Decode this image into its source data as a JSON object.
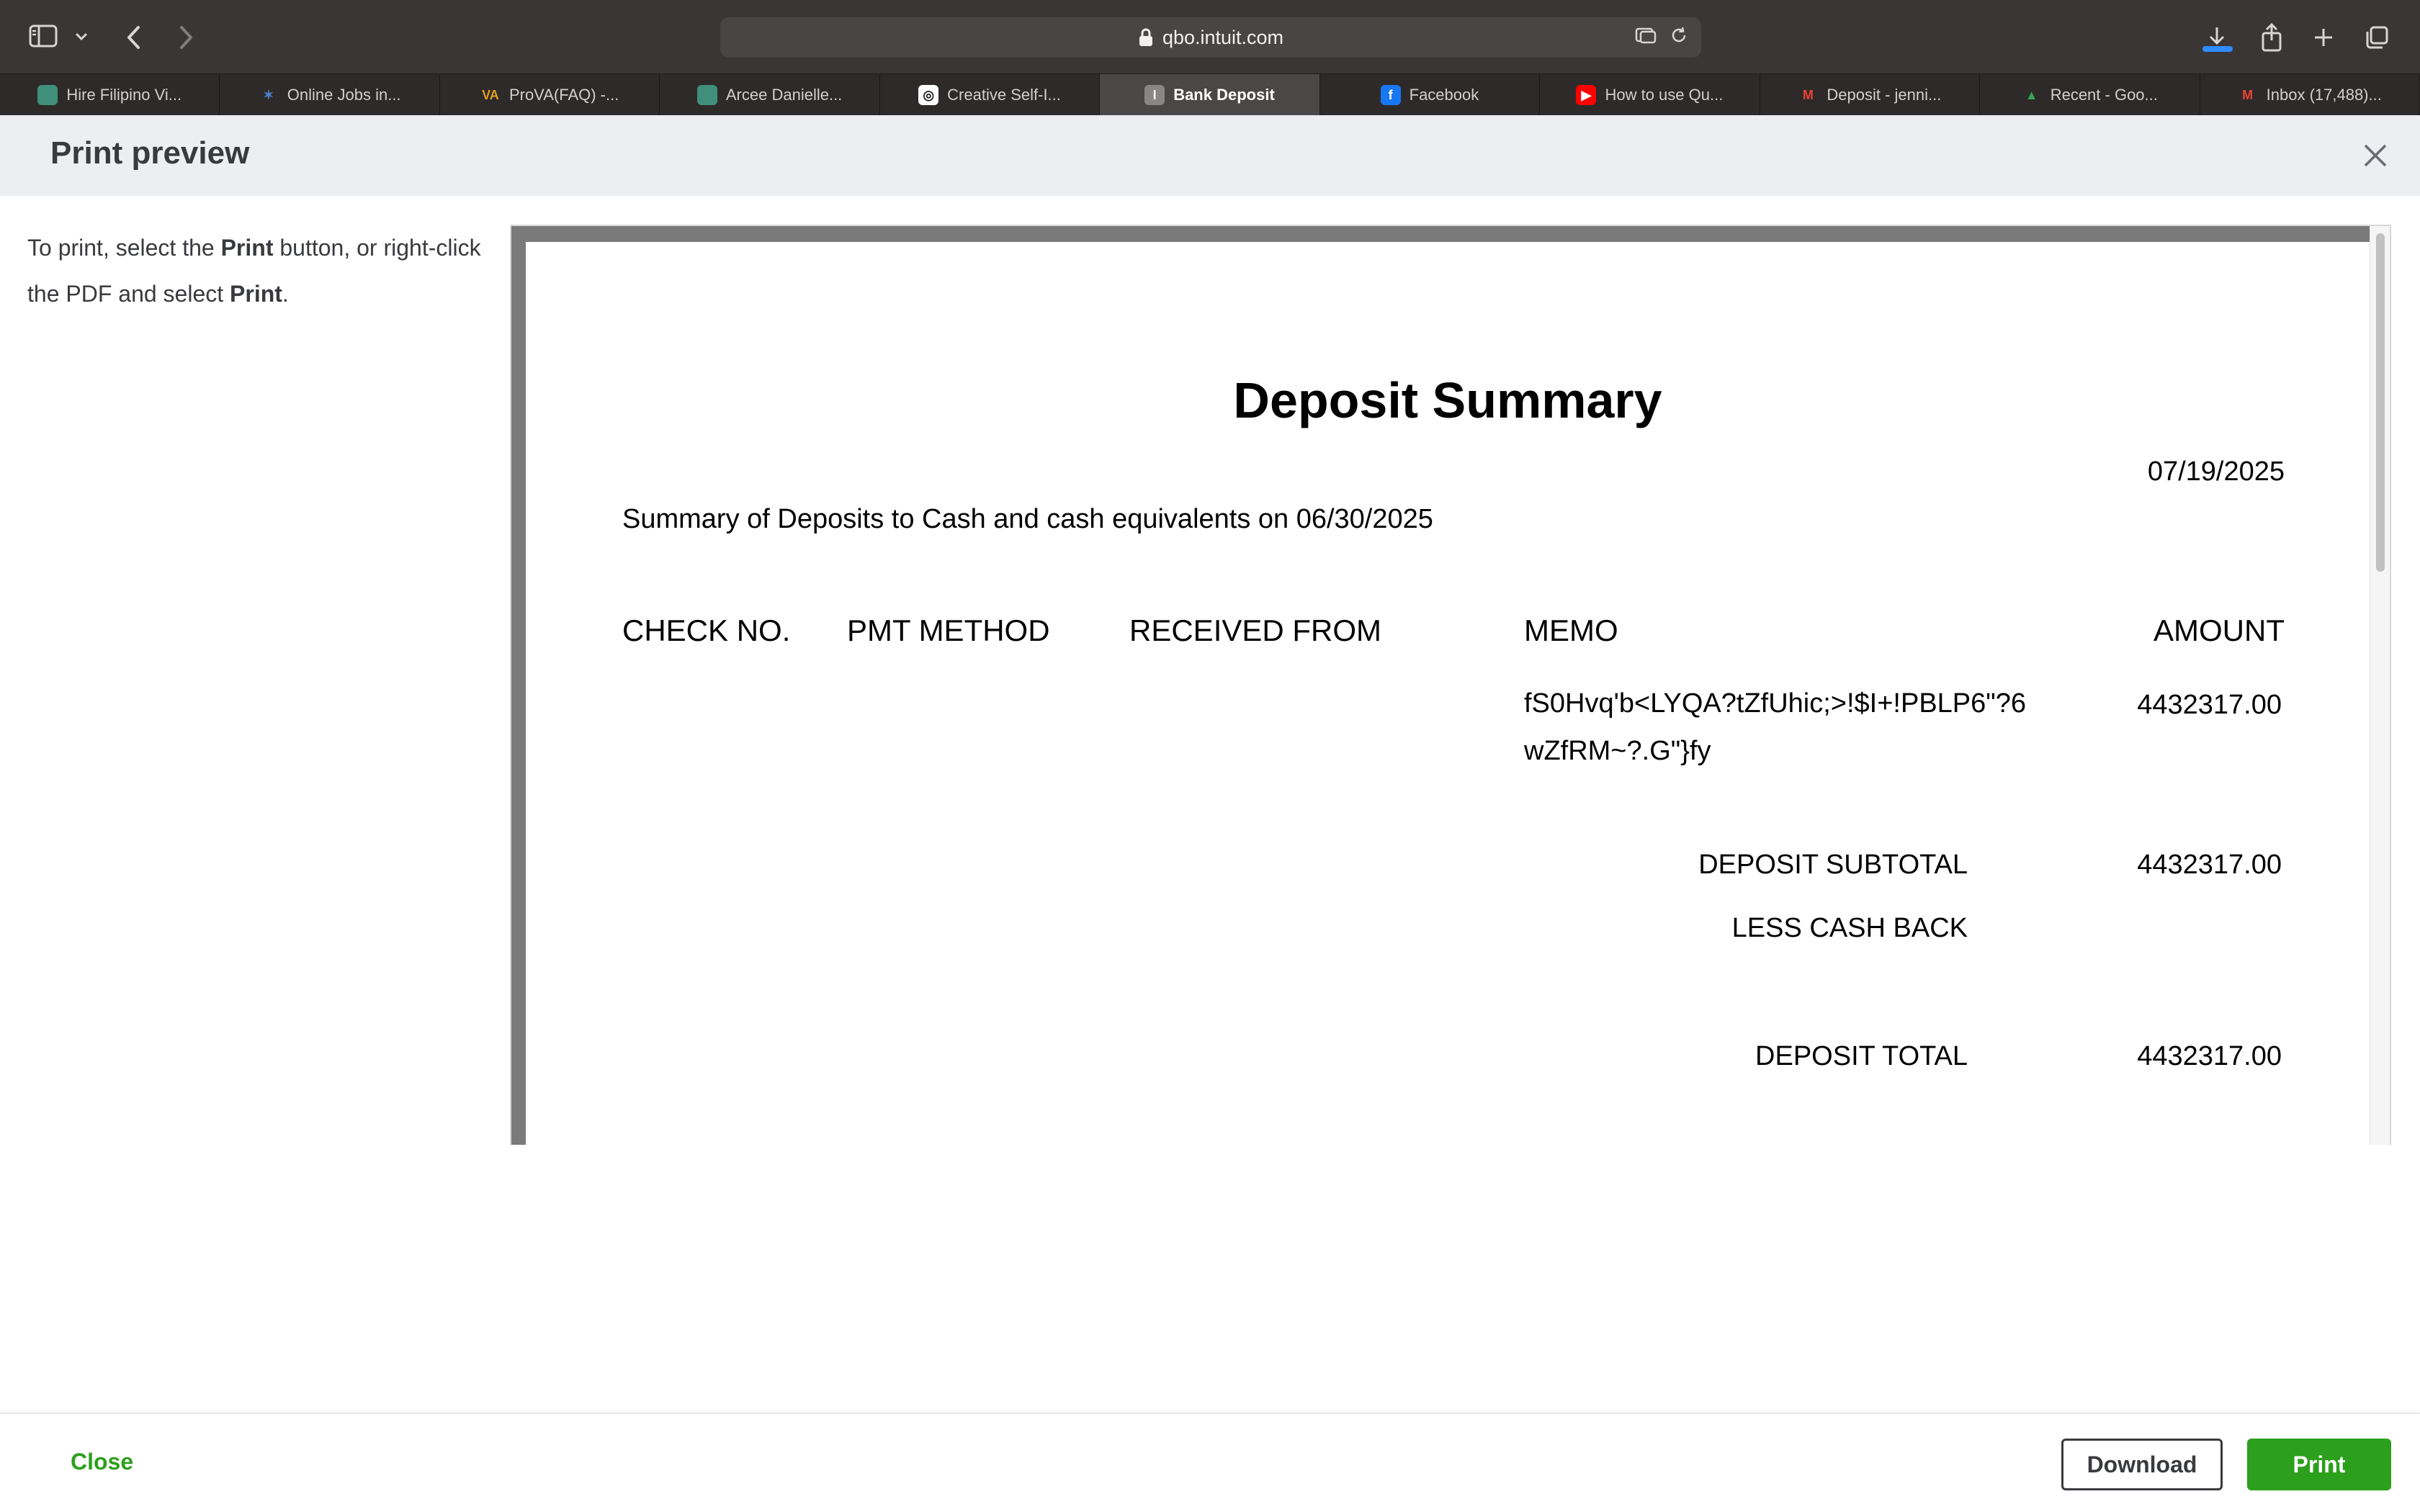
{
  "browser": {
    "url": "qbo.intuit.com",
    "tabs": [
      {
        "label": "Hire Filipino Vi...",
        "icon": "photo-icon",
        "active": false
      },
      {
        "label": "Online Jobs in...",
        "icon": "runner-icon",
        "active": false
      },
      {
        "label": "ProVA(FAQ) -...",
        "icon": "va-logo-icon",
        "active": false
      },
      {
        "label": "Arcee Danielle...",
        "icon": "photo-icon",
        "active": false
      },
      {
        "label": "Creative Self-I...",
        "icon": "circle-logo-icon",
        "active": false
      },
      {
        "label": "Bank Deposit",
        "icon": "intuit-icon",
        "active": true
      },
      {
        "label": "Facebook",
        "icon": "facebook-icon",
        "active": false
      },
      {
        "label": "How to use Qu...",
        "icon": "youtube-icon",
        "active": false
      },
      {
        "label": "Deposit - jenni...",
        "icon": "gmail-icon",
        "active": false
      },
      {
        "label": "Recent - Goo...",
        "icon": "drive-icon",
        "active": false
      },
      {
        "label": "Inbox (17,488)...",
        "icon": "gmail-icon",
        "active": false
      }
    ]
  },
  "header": {
    "title": "Print preview"
  },
  "instructions": {
    "part1": "To print, select the ",
    "bold1": "Print",
    "part2": " button, or right-click the PDF and select ",
    "bold2": "Print",
    "part3": "."
  },
  "document": {
    "title": "Deposit Summary",
    "date": "07/19/2025",
    "summary": "Summary of Deposits to Cash and cash equivalents on 06/30/2025",
    "columns": {
      "check_no": "CHECK NO.",
      "pmt_method": "PMT METHOD",
      "received_from": "RECEIVED FROM",
      "memo": "MEMO",
      "amount": "AMOUNT"
    },
    "line": {
      "memo": "fS0Hvq'b<LYQA?tZfUhic;>!$I+!PBLP6\"?6wZfRM~?.G\"}fy",
      "amount": "4432317.00"
    },
    "deposit_subtotal_label": "DEPOSIT SUBTOTAL",
    "deposit_subtotal": "4432317.00",
    "less_cash_back_label": "LESS CASH BACK",
    "deposit_total_label": "DEPOSIT TOTAL",
    "deposit_total": "4432317.00"
  },
  "footer": {
    "close_label": "Close",
    "download_label": "Download",
    "print_label": "Print"
  },
  "colors": {
    "accent_green": "#2ca01c",
    "header_bg": "#eceef1",
    "chrome_bg": "#3a3636"
  }
}
